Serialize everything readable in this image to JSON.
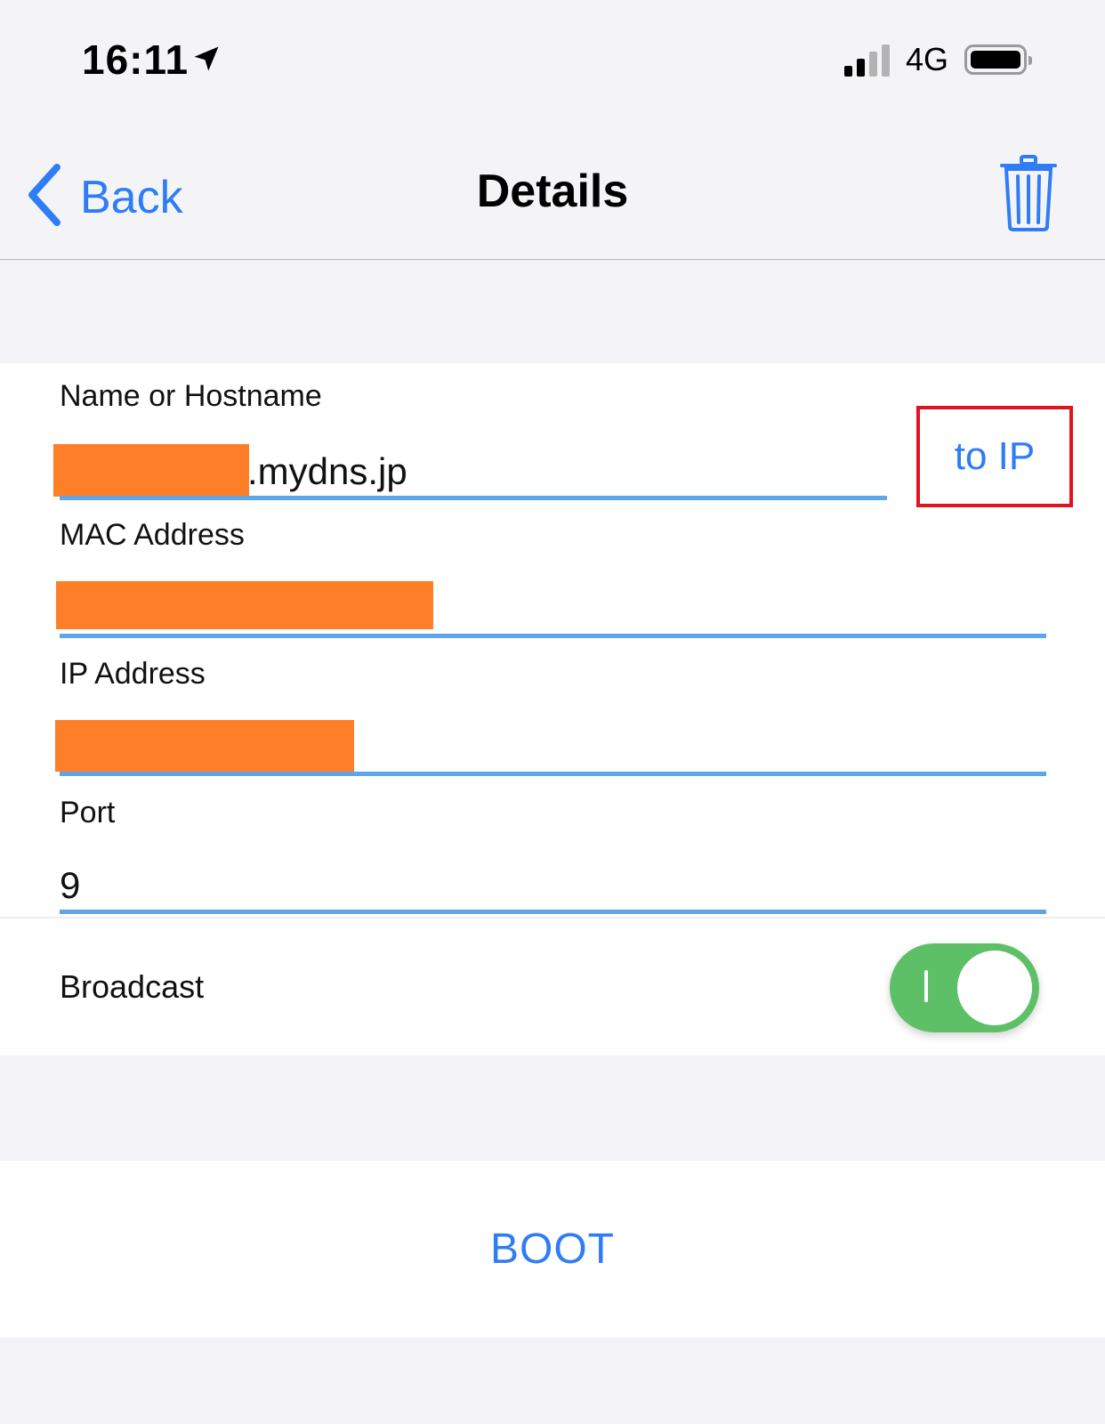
{
  "status_bar": {
    "time": "16:11",
    "location_icon": "location-arrow-icon",
    "network": "4G",
    "signal_icon": "cellular-signal-icon",
    "battery_icon": "battery-icon"
  },
  "nav": {
    "back_label": "Back",
    "back_icon": "chevron-left-icon",
    "title": "Details",
    "trash_icon": "trash-icon"
  },
  "form": {
    "hostname": {
      "label": "Name or Hostname",
      "value_suffix": ".mydns.jp"
    },
    "to_ip_button": "to IP",
    "mac": {
      "label": "MAC Address"
    },
    "ip": {
      "label": "IP Address"
    },
    "port": {
      "label": "Port",
      "value": "9"
    }
  },
  "broadcast": {
    "label": "Broadcast",
    "enabled": true
  },
  "boot_label": "BOOT",
  "colors": {
    "accent": "#2f7df6",
    "underline": "#5ea5ea",
    "toggle_on": "#5dc067",
    "redaction": "#fe7f27",
    "highlight_box": "#e0141e"
  }
}
